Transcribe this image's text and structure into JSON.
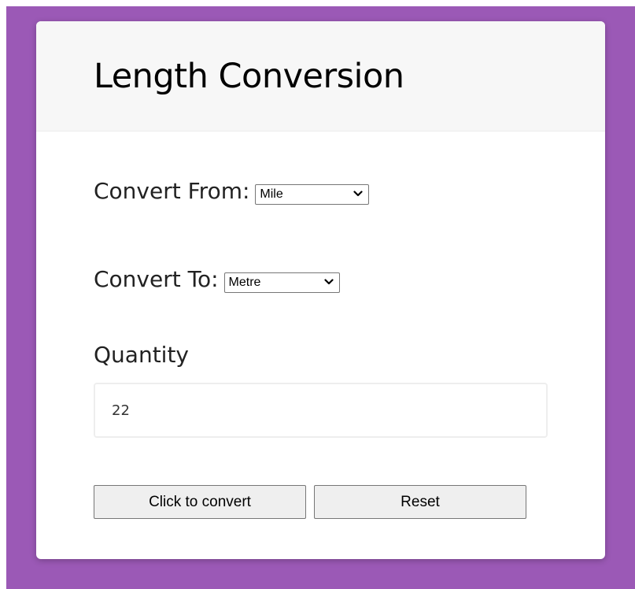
{
  "card": {
    "title": "Length Conversion"
  },
  "form": {
    "from_label": "Convert From:",
    "from_selected": "Mile",
    "to_label": "Convert To:",
    "to_selected": "Metre",
    "quantity_label": "Quantity",
    "quantity_value": "22"
  },
  "buttons": {
    "convert_label": "Click to convert",
    "reset_label": "Reset"
  },
  "icons": {
    "dropdown": "chevron-down-icon"
  },
  "colors": {
    "page_background": "#9b59b6",
    "card_background": "#ffffff",
    "header_background": "#f7f7f7",
    "button_background": "#efefef"
  }
}
